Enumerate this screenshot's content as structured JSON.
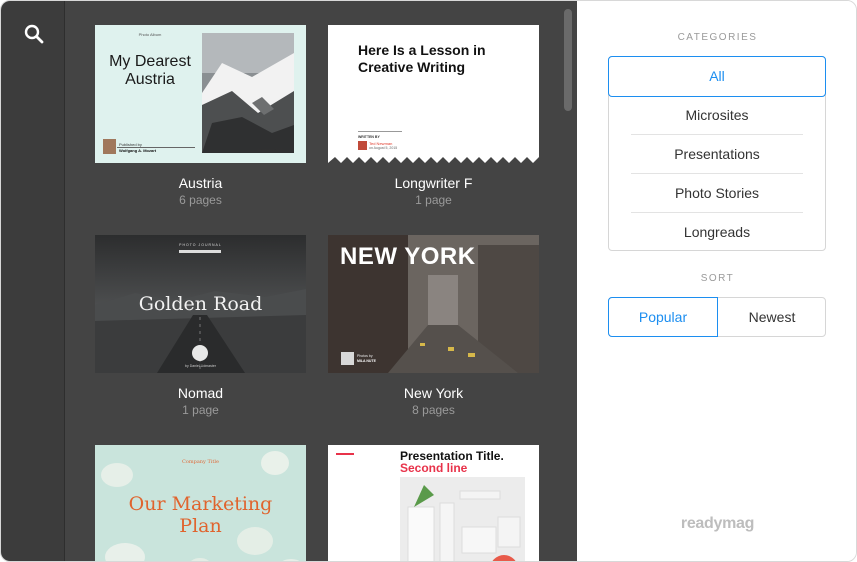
{
  "sidebar": {
    "search_icon": "search-icon"
  },
  "cards": [
    {
      "title": "Austria",
      "pages": "6 pages",
      "thumb": {
        "kicker": "Photo Album",
        "headline": "My Dearest Austria",
        "byline_top": "Published by",
        "byline_name": "Wolfgang A. Mozart",
        "date": "September 2015",
        "bg": "#dff2ee"
      }
    },
    {
      "title": "Longwriter F",
      "pages": "1 page",
      "thumb": {
        "headline": "Here Is a Lesson in Creative Writing",
        "kicker": "WRITTEN BY",
        "author": "Ted Newman",
        "date": "on August 5, 2015"
      }
    },
    {
      "title": "Nomad",
      "pages": "1 page",
      "thumb": {
        "kicker": "PHOTO JOURNAL",
        "headline": "Golden Road",
        "credit": "by Daniel Lidmaster"
      }
    },
    {
      "title": "New York",
      "pages": "8 pages",
      "thumb": {
        "headline": "NEW YORK",
        "byline_top": "Photos by",
        "byline_name": "MILA NUTE"
      }
    },
    {
      "title": "",
      "pages": "",
      "thumb": {
        "kicker": "Company Title",
        "headline": "Our Marketing Plan",
        "bg": "#c9e4dc"
      }
    },
    {
      "title": "",
      "pages": "",
      "thumb": {
        "headline": "Presentation Title.",
        "subhead": "Second line"
      }
    }
  ],
  "panel": {
    "categories_label": "CATEGORIES",
    "categories": [
      "All",
      "Microsites",
      "Presentations",
      "Photo Stories",
      "Longreads"
    ],
    "active_category": "All",
    "sort_label": "SORT",
    "sort": {
      "popular": "Popular",
      "newest": "Newest",
      "active": "Popular"
    },
    "brand": "readymag"
  },
  "colors": {
    "accent": "#1c8ef0",
    "gallery_bg": "#444444",
    "rail_bg": "#3c3c3c"
  }
}
